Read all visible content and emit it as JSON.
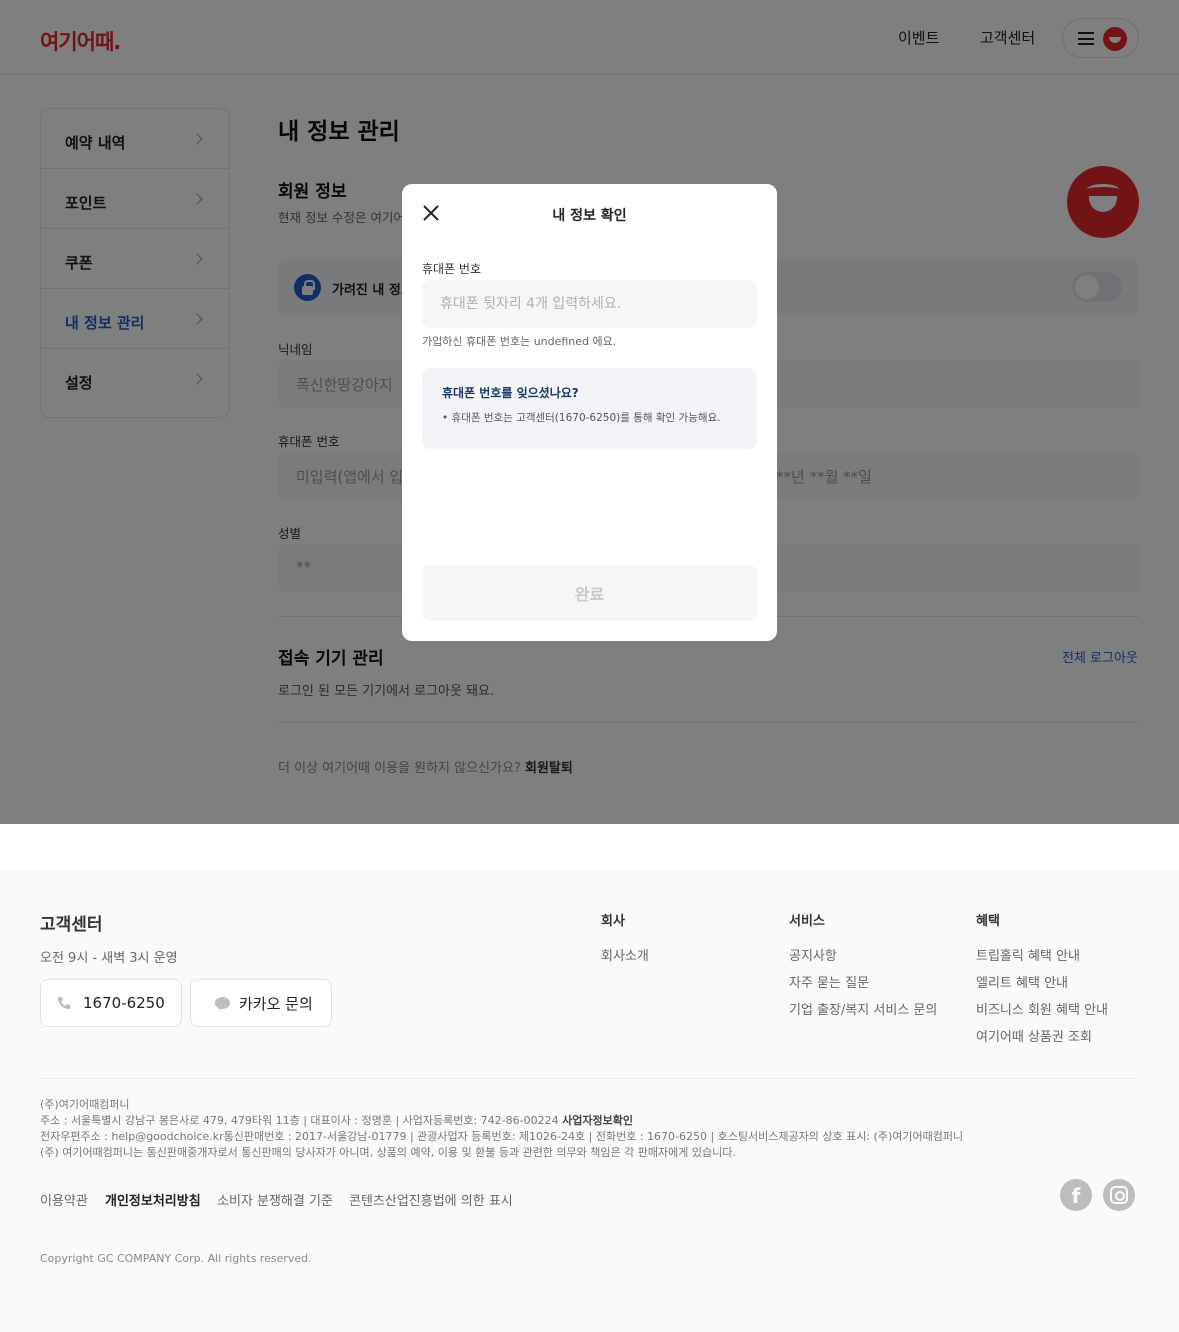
{
  "header": {
    "logo": "여기어때.",
    "nav_event": "이벤트",
    "nav_support": "고객센터"
  },
  "sidebar": {
    "items": [
      {
        "label": "예약 내역"
      },
      {
        "label": "포인트"
      },
      {
        "label": "쿠폰"
      },
      {
        "label": "내 정보 관리"
      },
      {
        "label": "설정"
      }
    ]
  },
  "main": {
    "page_title": "내 정보 관리",
    "member_title": "회원 정보",
    "member_desc": "현재 정보 수정은 여기어",
    "privacy_label": "가려진 내 정보",
    "nickname_label": "닉네임",
    "nickname_value": "폭신한땅강아지",
    "phone_label": "휴대폰 번호",
    "phone_value": "미입력(앱에서 입",
    "birth_value": "**년 **월 **일",
    "gender_label": "성별",
    "gender_value": "**",
    "device_title": "접속 기기 관리",
    "logout_all": "전체 로그아웃",
    "device_desc": "로그인 된 모든 기기에서 로그아웃 돼요.",
    "withdraw_question": "더 이상 여기어때 이용을 원하지 않으신가요?",
    "withdraw_link": "회원탈퇴"
  },
  "modal": {
    "title": "내 정보 확인",
    "phone_label": "휴대폰 번호",
    "phone_placeholder": "휴대폰 뒷자리 4개 입력하세요.",
    "hint": "가입하신 휴대폰 번호는 undefined 에요.",
    "info_title": "휴대폰 번호를 잊으셨나요?",
    "info_body": "• 휴대폰 번호는 고객센터(1670-6250)를 통해 확인 가능해요.",
    "submit": "완료"
  },
  "footer": {
    "title": "고객센터",
    "hours": "오전 9시 - 새벽 3시 운영",
    "phone": "1670-6250",
    "kakao": "카카오 문의",
    "company_title": "회사",
    "company_links": [
      "회사소개"
    ],
    "service_title": "서비스",
    "service_links": [
      "공지사항",
      "자주 묻는 질문",
      "기업 출장/복지 서비스 문의"
    ],
    "benefit_title": "혜택",
    "benefit_links": [
      "트립홀릭 혜택 안내",
      "엘리트 혜택 안내",
      "비즈니스 회원 혜택 안내",
      "여기어때 상품권 조회"
    ],
    "info_company": "(주)여기어때컴퍼니",
    "info_address": "주소 : 서울특별시 강남구 봉은사로 479, 479타워 11층 | 대표이사 : 정명훈 | 사업자등록번호: 742-86-00224",
    "info_biz_check": "사업자정보확인",
    "info_email": "전자우편주소 : help@goodchoice.kr통신판매번호 : 2017-서울강남-01779 | 관광사업자 등록번호: 제1026-24호 | 전화번호 : 1670-6250 | 호스팅서비스제공자의 상호 표시: (주)여기어때컴퍼니",
    "info_disclaimer": "(주) 여기어때컴퍼니는 통신판매중개자로서 통신판매의 당사자가 아니며, 상품의 예약, 이용 및 환불 등과 관련한 의무와 책임은 각 판매자에게 있습니다.",
    "policy_terms": "이용약관",
    "policy_privacy": "개인정보처리방침",
    "policy_dispute": "소비자 분쟁해결 기준",
    "policy_content": "콘텐츠산업진흥법에 의한 표시",
    "copyright": "Copyright GC COMPANY Corp. All rights reserved."
  },
  "colors": {
    "brand": "#e4262c",
    "accent": "#1e5ec9"
  }
}
